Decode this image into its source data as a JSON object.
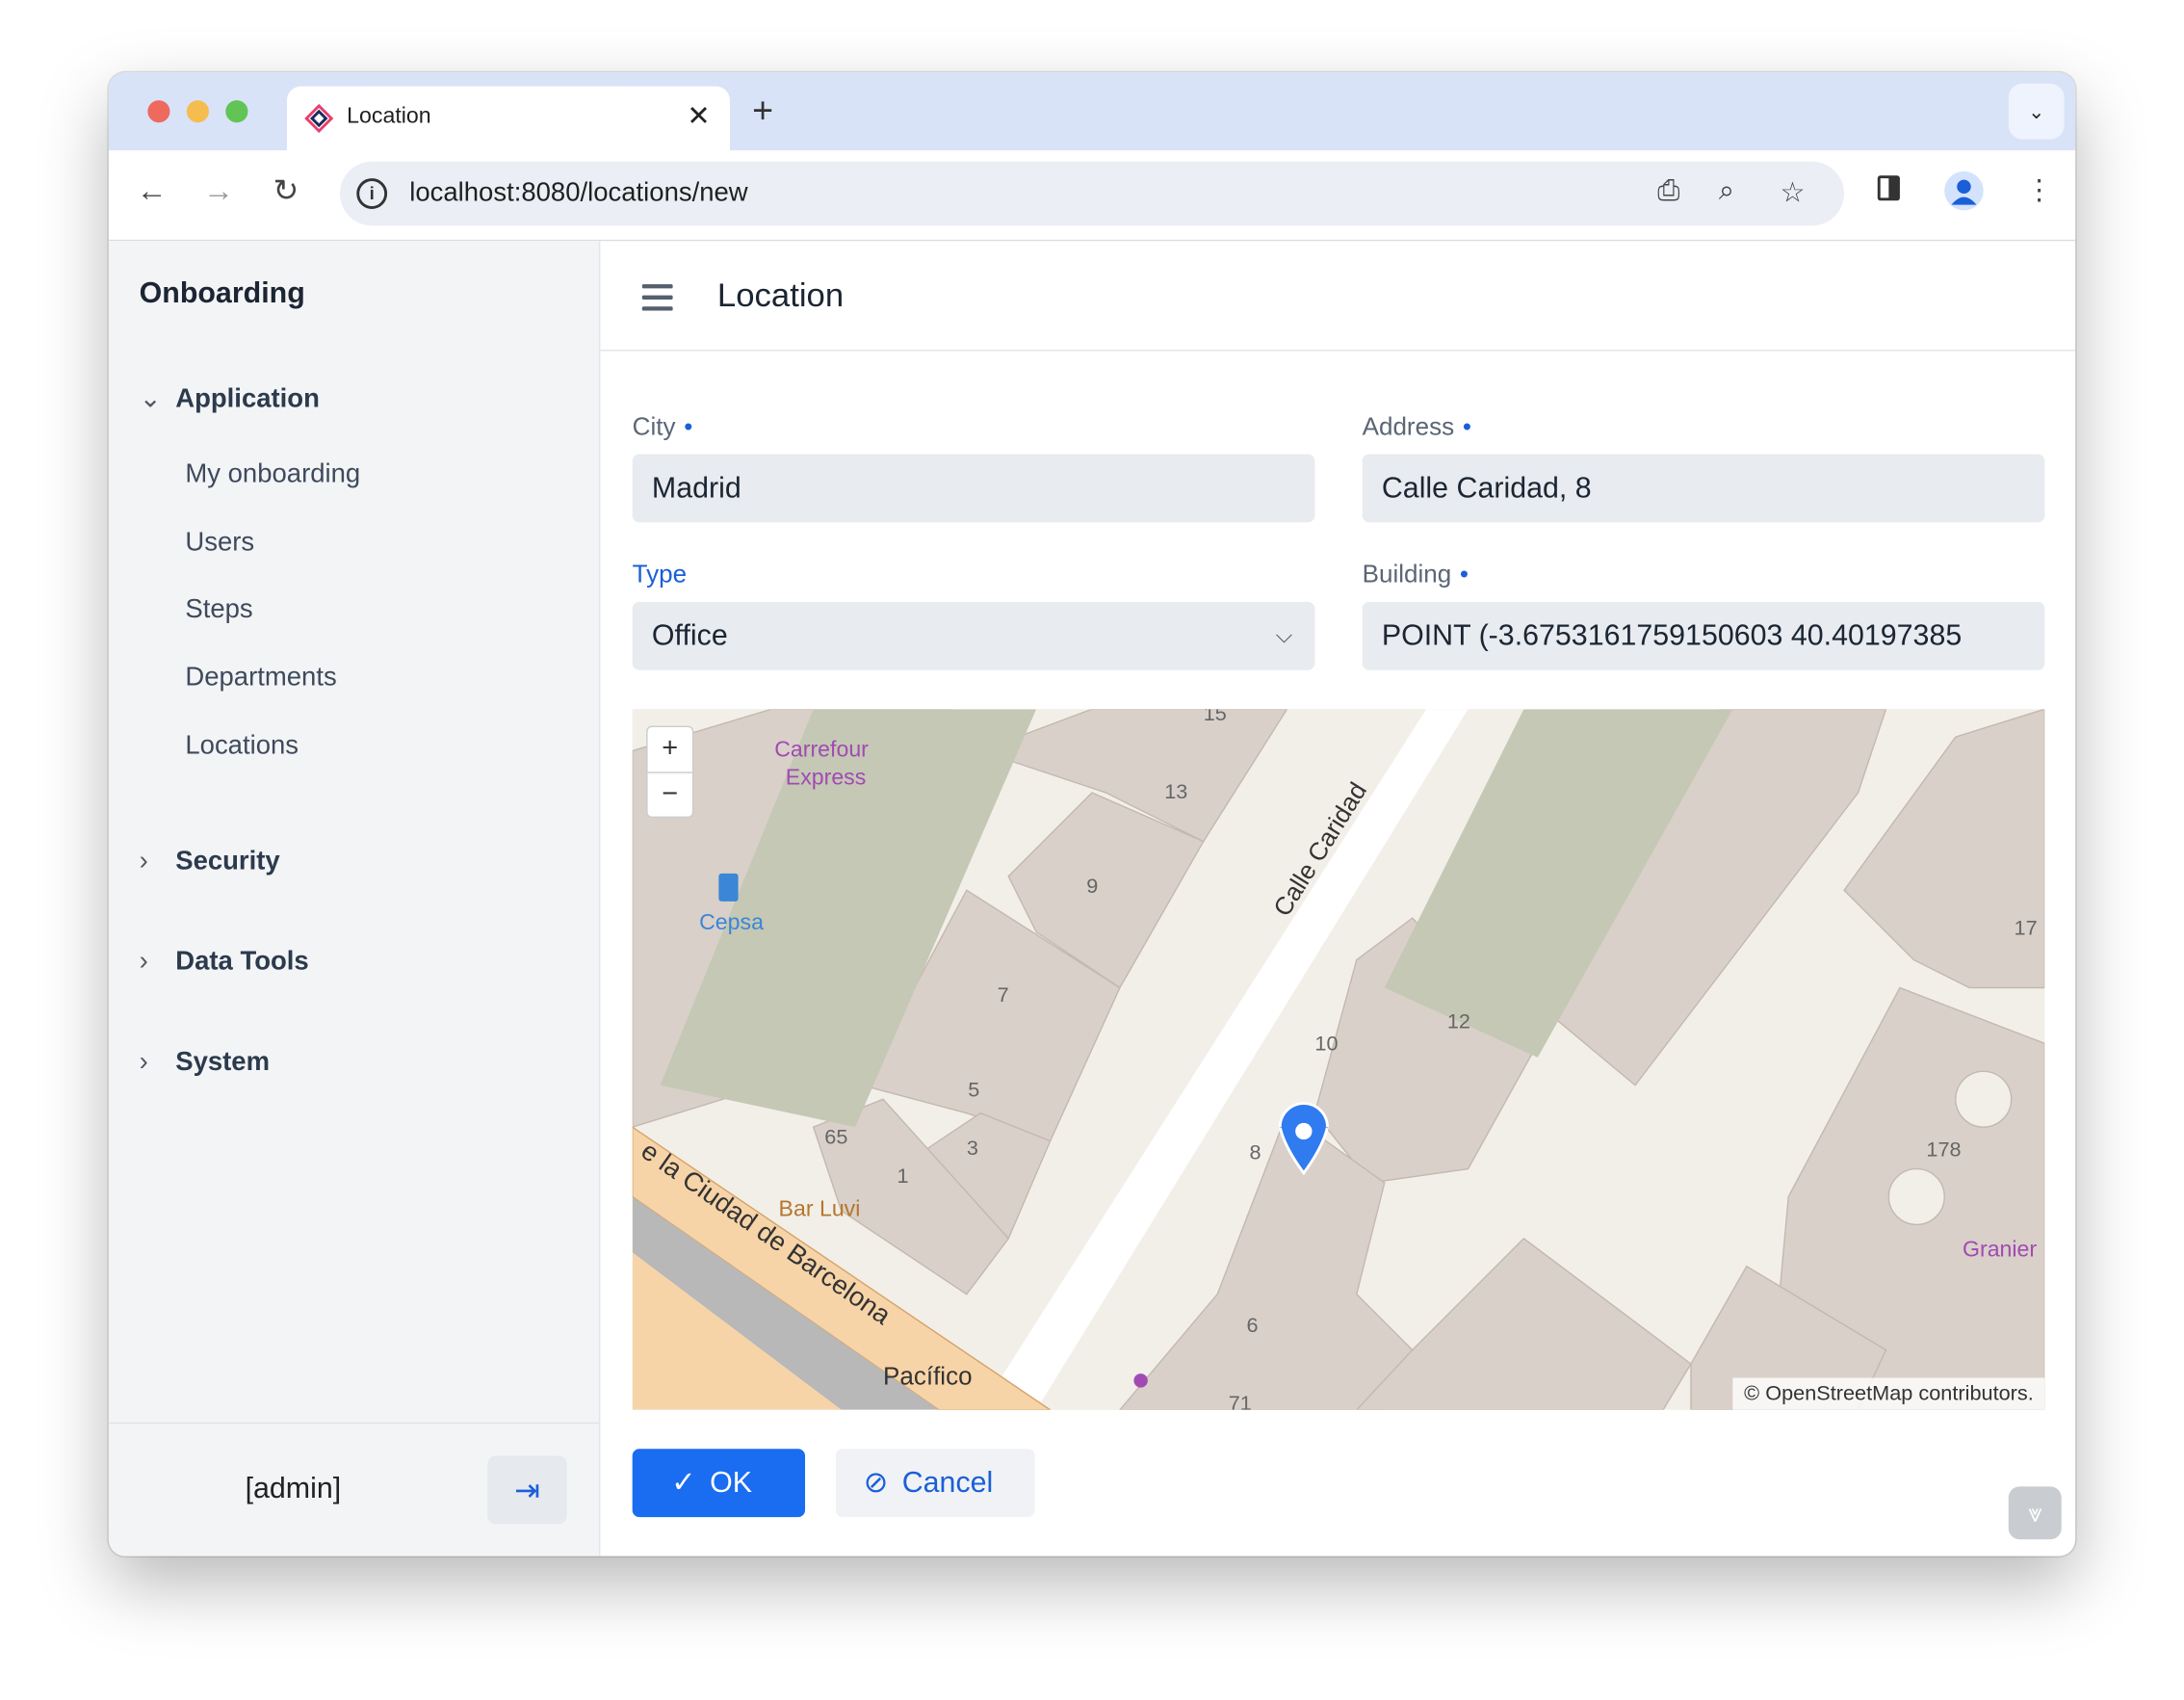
{
  "browser": {
    "tab_title": "Location",
    "tab_close": "✕",
    "new_tab": "+",
    "tab_menu": "⌄",
    "url": "localhost:8080/locations/new",
    "icons": [
      "back-icon",
      "forward-icon",
      "reload-icon",
      "site-info-icon",
      "install-app-icon",
      "zoom-icon",
      "bookmark-star-icon",
      "side-panel-icon",
      "profile-icon",
      "more-menu-icon"
    ],
    "traffic_lights": {
      "close": "#ee6a5f",
      "minimize": "#f5bd4f",
      "maximize": "#61c454"
    }
  },
  "sidebar": {
    "brand": "Onboarding",
    "groups": [
      {
        "label": "Application",
        "expanded": true,
        "items": [
          "My onboarding",
          "Users",
          "Steps",
          "Departments",
          "Locations"
        ]
      },
      {
        "label": "Security",
        "expanded": false
      },
      {
        "label": "Data Tools",
        "expanded": false
      },
      {
        "label": "System",
        "expanded": false
      }
    ],
    "user": "[admin]"
  },
  "header": {
    "title": "Location"
  },
  "form": {
    "city": {
      "label": "City",
      "value": "Madrid",
      "required": true
    },
    "address": {
      "label": "Address",
      "value": "Calle Caridad, 8",
      "required": true
    },
    "type": {
      "label": "Type",
      "value": "Office"
    },
    "building": {
      "label": "Building",
      "value": "POINT (-3.6753161759150603 40.40197385",
      "required": true
    }
  },
  "map": {
    "zoom_in": "+",
    "zoom_out": "−",
    "attribution": "© OpenStreetMap contributors.",
    "labels": {
      "street1": "Calle Caridad",
      "street2": "e la Ciudad de Barcelona",
      "poi1": "Carrefour",
      "poi1b": "Express",
      "poi2": "Cepsa",
      "poi3": "Bar Luvi",
      "poi4": "Granier",
      "poi5": "Pacífico",
      "n9": "9",
      "n13": "13",
      "n7": "7",
      "n5": "5",
      "n3": "3",
      "n1": "1",
      "n65": "65",
      "n10": "10",
      "n12": "12",
      "n8": "8",
      "n6": "6",
      "n178": "178",
      "n15": "15",
      "n17": "17",
      "n71": "71"
    }
  },
  "actions": {
    "ok": "OK",
    "cancel": "Cancel"
  },
  "colors": {
    "accent": "#1a6cf0",
    "marker": "#2f7bef"
  }
}
